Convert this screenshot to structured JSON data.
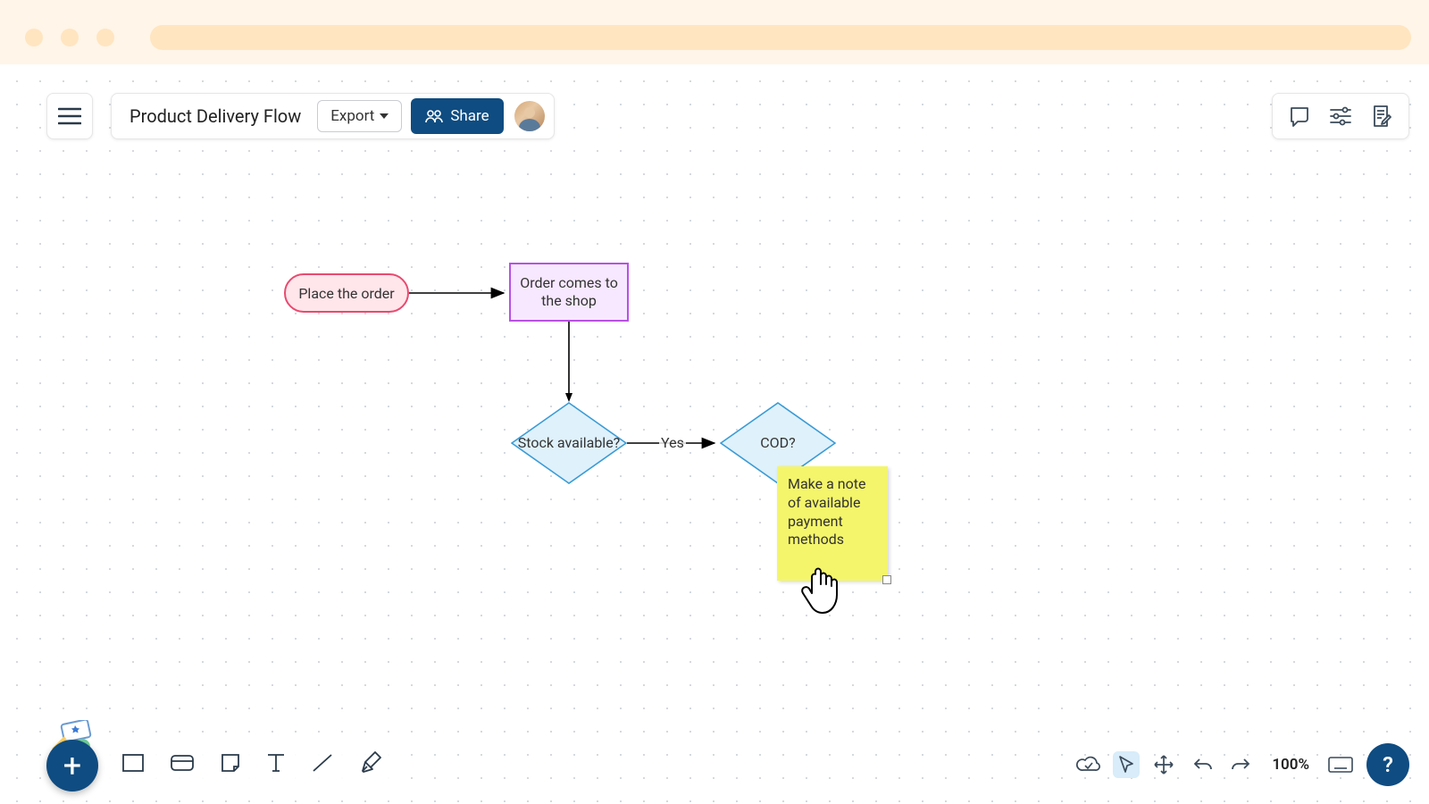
{
  "header": {
    "title": "Product Delivery Flow",
    "export_label": "Export",
    "share_label": "Share"
  },
  "flow": {
    "place_order": "Place the order",
    "order_shop": "Order comes to the shop",
    "stock_q": "Stock available?",
    "cod_q": "COD?",
    "edge_yes": "Yes",
    "sticky": "Make a note of available payment methods"
  },
  "bottom_right": {
    "zoom": "100%",
    "help": "?"
  },
  "icons": {
    "plus": "+"
  }
}
